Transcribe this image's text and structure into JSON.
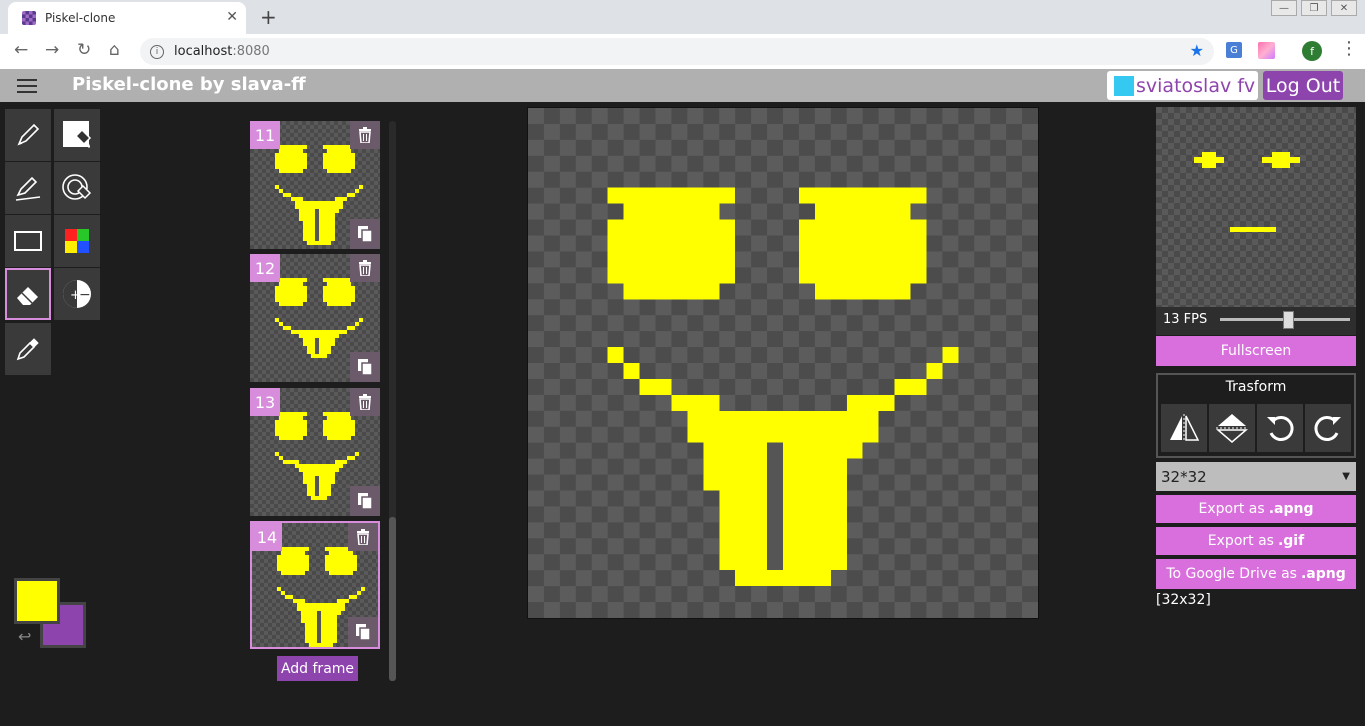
{
  "browser": {
    "tab_title": "Piskel-clone",
    "close_tab": "✕",
    "new_tab": "+",
    "url_host": "localhost",
    "url_port": ":8080",
    "extension_label": "G",
    "profile_initial": "f"
  },
  "app": {
    "title": "Piskel-clone by slava-ff",
    "user_name": "sviatoslav fv",
    "logout_label": "Log Out"
  },
  "colors": {
    "primary": "#ffff00",
    "secondary": "#8e44ad",
    "accent": "#d96fdc"
  },
  "tools": [
    "pen-tool",
    "paint-bucket-tool",
    "stroke-tool",
    "paint-same-pixels-tool",
    "rectangle-tool",
    "color-swap-tool",
    "eraser-tool",
    "lighten-tool",
    "eyedropper-tool"
  ],
  "frames": [
    {
      "number": "11",
      "mouth": "v1",
      "selected": false
    },
    {
      "number": "12",
      "mouth": "v2",
      "selected": false
    },
    {
      "number": "13",
      "mouth": "v3",
      "selected": false
    },
    {
      "number": "14",
      "mouth": "v1",
      "selected": true
    }
  ],
  "add_frame_label": "Add frame",
  "preview": {
    "fps_label": "13 FPS",
    "fps": 13,
    "fps_fraction": 0.55,
    "fullscreen_label": "Fullscreen"
  },
  "transform": {
    "title": "Trasform",
    "buttons": [
      "flip-horizontal",
      "flip-vertical",
      "rotate-left",
      "rotate-right"
    ]
  },
  "canvas_size": {
    "selected": "32*32",
    "dimensions_text": "[32x32]"
  },
  "export": {
    "apng_prefix": "Export as",
    "apng_suffix": ".apng",
    "gif_prefix": "Export as",
    "gif_suffix": ".gif",
    "drive_prefix": "To Google Drive as",
    "drive_suffix": ".apng"
  }
}
